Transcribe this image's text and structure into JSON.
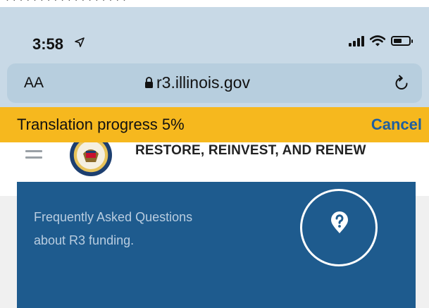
{
  "status_bar": {
    "time": "3:58",
    "location_icon": "location-arrow-icon",
    "signal_icon": "cellular-signal-icon",
    "wifi_icon": "wifi-icon",
    "battery_icon": "battery-icon"
  },
  "browser": {
    "text_size_label": "AA",
    "url": "r3.illinois.gov",
    "lock_icon": "lock-icon",
    "reload_icon": "reload-icon"
  },
  "translation": {
    "progress_label": "Translation progress 5%",
    "progress_percent": 5,
    "cancel_label": "Cancel"
  },
  "site": {
    "title": "RESTORE, REINVEST, AND RENEW",
    "menu_icon": "hamburger-menu-icon",
    "logo": "state-seal-logo"
  },
  "card": {
    "line1": "Frequently Asked Questions",
    "line2": "about R3 funding.",
    "icon": "question-location-pin-icon"
  },
  "colors": {
    "chrome_bg": "#c8d9e6",
    "translate_bar": "#f6b81e",
    "cancel_link": "#1f5fa0",
    "card_bg": "#1e5b8e"
  }
}
